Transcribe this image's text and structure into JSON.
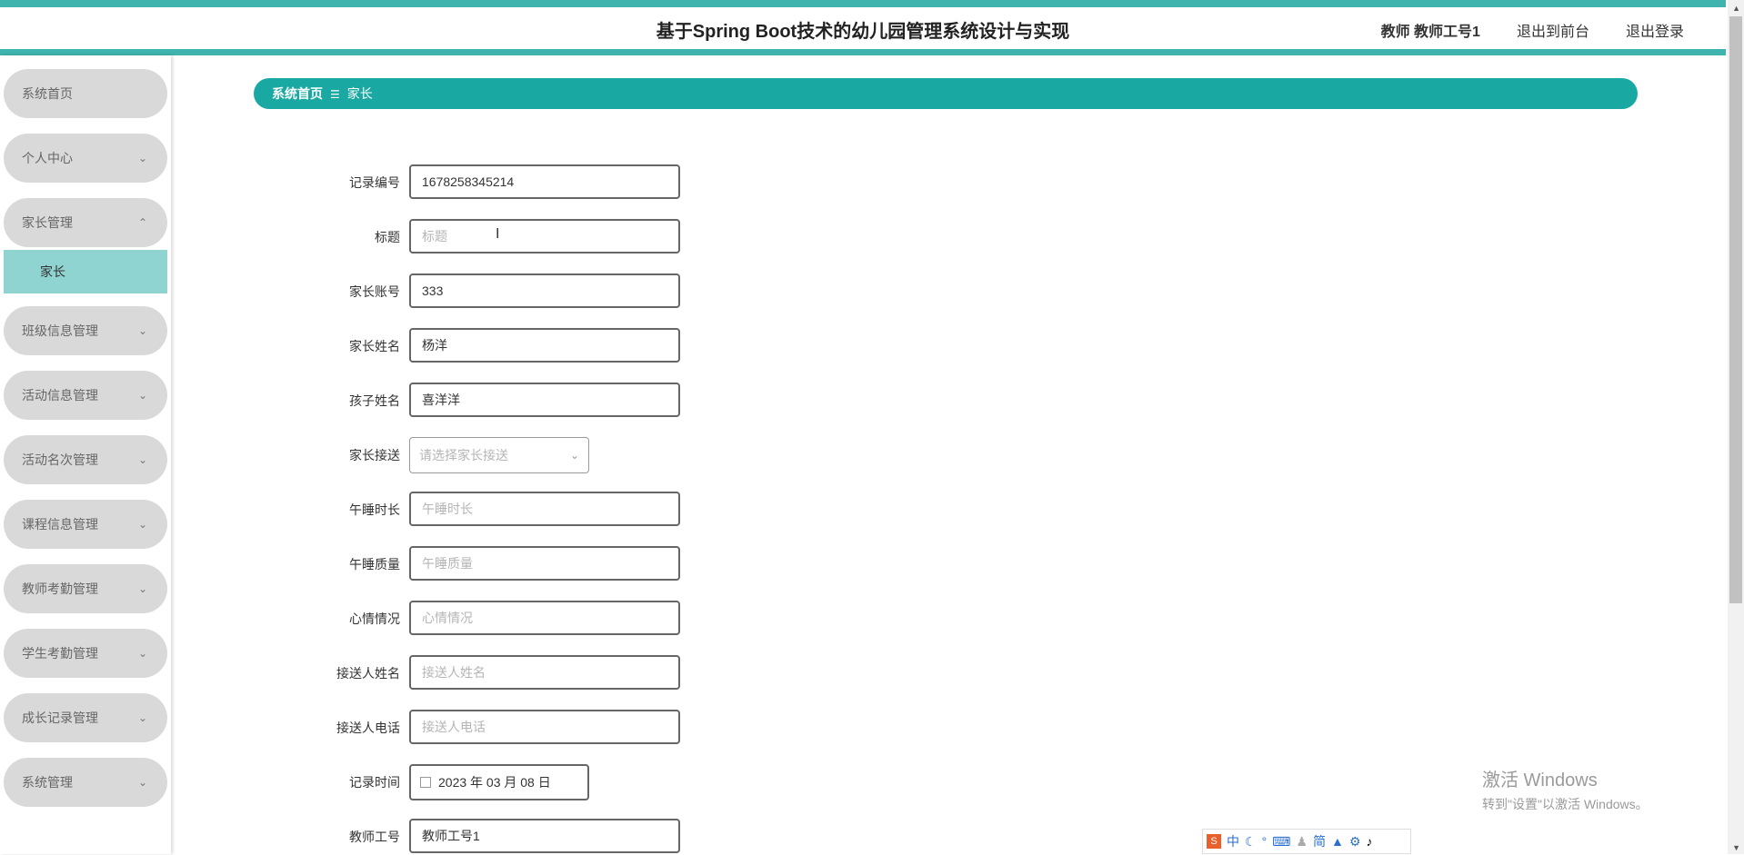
{
  "app": {
    "title": "基于Spring Boot技术的幼儿园管理系统设计与实现",
    "user_label": "教师 教师工号1",
    "front_link": "退出到前台",
    "logout_link": "退出登录"
  },
  "sidebar": {
    "items": [
      {
        "label": "系统首页",
        "has_chevron": false
      },
      {
        "label": "个人中心",
        "has_chevron": true
      },
      {
        "label": "家长管理",
        "has_chevron": true,
        "expanded": true
      },
      {
        "label": "班级信息管理",
        "has_chevron": true
      },
      {
        "label": "活动信息管理",
        "has_chevron": true
      },
      {
        "label": "活动名次管理",
        "has_chevron": true
      },
      {
        "label": "课程信息管理",
        "has_chevron": true
      },
      {
        "label": "教师考勤管理",
        "has_chevron": true
      },
      {
        "label": "学生考勤管理",
        "has_chevron": true
      },
      {
        "label": "成长记录管理",
        "has_chevron": true
      },
      {
        "label": "系统管理",
        "has_chevron": true
      }
    ],
    "submenu_active": "家长"
  },
  "breadcrumb": {
    "home": "系统首页",
    "separator": "☰",
    "current": "家长"
  },
  "form": {
    "record_no": {
      "label": "记录编号",
      "value": "1678258345214"
    },
    "title": {
      "label": "标题",
      "placeholder": "标题"
    },
    "parent_account": {
      "label": "家长账号",
      "value": "333"
    },
    "parent_name": {
      "label": "家长姓名",
      "value": "杨洋"
    },
    "child_name": {
      "label": "孩子姓名",
      "value": "喜洋洋"
    },
    "pickup": {
      "label": "家长接送",
      "placeholder": "请选择家长接送"
    },
    "nap_duration": {
      "label": "午睡时长",
      "placeholder": "午睡时长"
    },
    "nap_quality": {
      "label": "午睡质量",
      "placeholder": "午睡质量"
    },
    "mood": {
      "label": "心情情况",
      "placeholder": "心情情况"
    },
    "pickup_person_name": {
      "label": "接送人姓名",
      "placeholder": "接送人姓名"
    },
    "pickup_person_phone": {
      "label": "接送人电话",
      "placeholder": "接送人电话"
    },
    "record_time": {
      "label": "记录时间",
      "value": "2023 年 03 月 08 日"
    },
    "teacher_id": {
      "label": "教师工号",
      "value": "教师工号1"
    }
  },
  "watermark": {
    "line1": "激活 Windows",
    "line2": "转到\"设置\"以激活 Windows。"
  },
  "ime": {
    "logo": "S",
    "mode": "中",
    "simplified": "简"
  }
}
